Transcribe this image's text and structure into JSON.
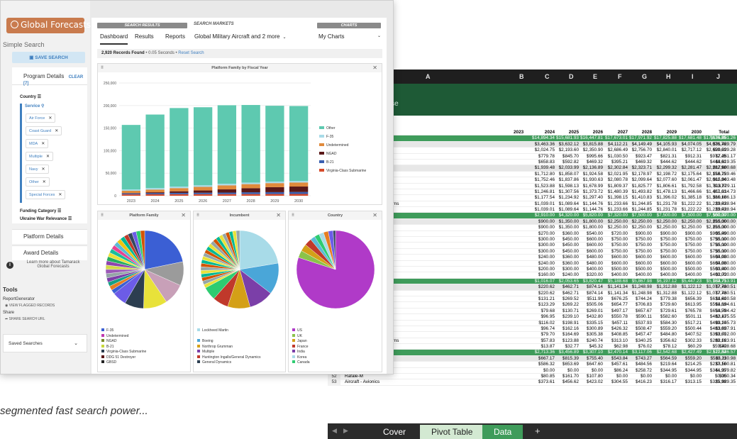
{
  "app": {
    "logo_text": "Global Forecasts",
    "simple_search": "Simple Search",
    "save_search": "SAVE SEARCH",
    "program_details": "Program Details",
    "clear_label": "CLEAR [7]",
    "filters": {
      "country": "Country",
      "service": "Service",
      "funding_category": "Funding Category",
      "ukraine_war": "Ukraine War Relevance"
    },
    "service_chips": [
      "Air Force",
      "Coast Guard",
      "MDA",
      "Multiple",
      "Navy",
      "Other",
      "Special Forces"
    ],
    "platform_details": "Platform Details",
    "award_details": "Award Details",
    "learn_more": "Learn more about Tamarack Global Forecasts",
    "tools": {
      "title": "Tools",
      "report_generator": "ReportGenerator",
      "view_flagged": "VIEW FLAGGED RECORDS",
      "share": "Share",
      "share_url": "SHARE SEARCH URL"
    },
    "saved_searches": "Saved Searches"
  },
  "main": {
    "groups": {
      "search_results": "SEARCH RESULTS",
      "search_markets": "SEARCH MARKETS",
      "charts": "CHARTS"
    },
    "tabs": [
      "Dashboard",
      "Results",
      "Reports"
    ],
    "market_select": "Global Military Aircraft and 2 more",
    "charts_select": "My Charts",
    "records_count": "2,920 Records Found",
    "records_time": "0.05 Seconds",
    "reset_search": "Reset Search"
  },
  "colors": {
    "other": "#5ec9b0",
    "f35": "#a8dbe8",
    "undetermined": "#e08a3c",
    "ngad": "#5a1818",
    "b21": "#3a5fb0",
    "vcs": "#d64a2a"
  },
  "chart_data": [
    {
      "type": "bar",
      "title": "Platform Family by Fiscal Year",
      "categories": [
        "2023",
        "2024",
        "2025",
        "2026",
        "2027",
        "2028",
        "2029",
        "2030"
      ],
      "ylim": [
        0,
        250000
      ],
      "yticks": [
        "0",
        "50,000",
        "100,000",
        "150,000",
        "200,000",
        "250,000"
      ],
      "series": [
        {
          "name": "Virginia-Class Submarine",
          "values": [
            3000,
            3200,
            3400,
            3500,
            3600,
            3700,
            3800,
            3900
          ]
        },
        {
          "name": "B-21",
          "values": [
            2000,
            2500,
            3000,
            3200,
            3500,
            4000,
            4200,
            4500
          ]
        },
        {
          "name": "NGAD",
          "values": [
            1000,
            2000,
            3500,
            5000,
            7000,
            9000,
            11000,
            12000
          ]
        },
        {
          "name": "Undetermined",
          "values": [
            5000,
            6000,
            7000,
            8000,
            9000,
            9000,
            9000,
            9000
          ]
        },
        {
          "name": "F-35",
          "values": [
            3000,
            3300,
            3500,
            3500,
            3500,
            3500,
            3500,
            3500
          ]
        },
        {
          "name": "Other",
          "values": [
            143000,
            163000,
            174000,
            173000,
            174000,
            172000,
            168000,
            166000
          ]
        }
      ]
    },
    {
      "type": "pie",
      "title": "Platform Family",
      "legend": [
        "F-35",
        "Undetermined",
        "NGAD",
        "B-21",
        "Virginia-Class Submarine",
        "DDG 51 Destroyer",
        "GBSD"
      ]
    },
    {
      "type": "pie",
      "title": "Incumbent",
      "legend": [
        "Lockheed Martin",
        "",
        "Boeing",
        "Northrop Grumman",
        "Multiple",
        "Huntington Ingalls/General Dynamics",
        "General Dynamics"
      ]
    },
    {
      "type": "pie",
      "title": "Country",
      "legend": [
        "US",
        "UK",
        "Japan",
        "France",
        "India",
        "Korea",
        "Canada"
      ]
    }
  ],
  "sheet": {
    "columns": [
      "A",
      "B",
      "C",
      "D",
      "E",
      "F",
      "G",
      "H",
      "I",
      "J"
    ],
    "subtitle": "ense",
    "year_headers": [
      "2023",
      "2024",
      "2025",
      "2026",
      "2027",
      "2028",
      "2029",
      "2030",
      "Total"
    ],
    "rows": [
      {
        "label": "",
        "vals": [
          "$14,894.34",
          "$15,681.93",
          "$16,447.81",
          "$17,673.01",
          "$17,971.92",
          "$17,825.88",
          "$17,681.48",
          "$17,674.89",
          "$135,851.26"
        ],
        "style": "green"
      },
      {
        "label": "es",
        "vals": [
          "$3,463.36",
          "$3,632.12",
          "$3,815.88",
          "$4,112.21",
          "$4,149.49",
          "$4,105.93",
          "$4,074.05",
          "$4,076.76",
          "$31,429.79"
        ],
        "style": "gray"
      },
      {
        "label": "",
        "vals": [
          "$2,024.75",
          "$2,193.60",
          "$2,350.90",
          "$2,686.49",
          "$2,756.70",
          "$2,840.01",
          "$2,717.12",
          "$2,659.69",
          "$20,229.28"
        ],
        "style": ""
      },
      {
        "label": "",
        "vals": [
          "$779.78",
          "$845.70",
          "$995.66",
          "$1,030.50",
          "$923.47",
          "$821.31",
          "$912.31",
          "$972.45",
          "$7,281.17"
        ],
        "style": ""
      },
      {
        "label": "",
        "vals": [
          "$658.83",
          "$592.82",
          "$469.32",
          "$395.21",
          "$469.32",
          "$444.62",
          "$444.62",
          "$444.62",
          "$3,919.35"
        ],
        "style": ""
      },
      {
        "label": "s",
        "vals": [
          "$1,939.48",
          "$2,033.99",
          "$2,136.89",
          "$2,302.84",
          "$2,323.71",
          "$2,299.32",
          "$2,281.47",
          "$2,282.98",
          "$17,600.68"
        ],
        "style": "gray"
      },
      {
        "label": "",
        "vals": [
          "$1,712.80",
          "$1,858.07",
          "$1,924.58",
          "$2,021.95",
          "$2,178.97",
          "$2,198.72",
          "$2,175.64",
          "$2,158.75",
          "$16,229.46"
        ],
        "style": ""
      },
      {
        "label": "on",
        "vals": [
          "$1,752.46",
          "$1,837.86",
          "$1,930.63",
          "$2,080.78",
          "$2,099.64",
          "$2,077.60",
          "$2,061.47",
          "$2,062.84",
          "$15,903.48"
        ],
        "style": ""
      },
      {
        "label": "",
        "vals": [
          "$1,523.88",
          "$1,598.13",
          "$1,678.99",
          "$1,809.37",
          "$1,825.77",
          "$1,806.61",
          "$1,792.58",
          "$1,793.77",
          "$13,829.11"
        ],
        "style": ""
      },
      {
        "label": "",
        "vals": [
          "$1,246.81",
          "$1,307.56",
          "$1,373.72",
          "$1,480.39",
          "$1,493.82",
          "$1,478.13",
          "$1,466.66",
          "$1,467.63",
          "$11,314.73"
        ],
        "style": ""
      },
      {
        "label": "",
        "vals": [
          "$1,177.54",
          "$1,234.92",
          "$1,297.40",
          "$1,398.15",
          "$1,410.83",
          "$1,396.02",
          "$1,385.18",
          "$1,386.10",
          "$10,686.13"
        ],
        "style": ""
      },
      {
        "label": "Systems",
        "vals": [
          "$1,039.01",
          "$1,089.64",
          "$1,144.76",
          "$1,233.66",
          "$1,244.85",
          "$1,231.78",
          "$1,222.22",
          "$1,223.03",
          "$9,428.94"
        ],
        "style": ""
      },
      {
        "label": "",
        "vals": [
          "$1,039.01",
          "$1,089.64",
          "$1,144.76",
          "$1,233.66",
          "$1,244.85",
          "$1,231.78",
          "$1,222.22",
          "$1,223.03",
          "$9,428.94"
        ],
        "style": ""
      },
      {
        "label": "",
        "vals": [
          "$2,910.00",
          "$4,320.00",
          "$5,820.00",
          "$7,320.00",
          "$7,500.00",
          "$7,500.00",
          "$7,500.00",
          "$7,500.00",
          "$50,370.00"
        ],
        "style": "green"
      },
      {
        "label": "es",
        "vals": [
          "$900.00",
          "$1,350.00",
          "$1,800.00",
          "$2,250.00",
          "$2,250.00",
          "$2,250.00",
          "$2,250.00",
          "$2,250.00",
          "$15,300.00"
        ],
        "style": "gray"
      },
      {
        "label": "",
        "vals": [
          "$900.00",
          "$1,350.00",
          "$1,800.00",
          "$2,250.00",
          "$2,250.00",
          "$2,250.00",
          "$2,250.00",
          "$2,250.00",
          "$15,300.00"
        ],
        "style": ""
      },
      {
        "label": "",
        "vals": [
          "$270.00",
          "$360.00",
          "$540.00",
          "$720.00",
          "$900.00",
          "$900.00",
          "$900.00",
          "$900.00",
          "$5,490.00"
        ],
        "style": ""
      },
      {
        "label": "",
        "vals": [
          "$300.00",
          "$450.00",
          "$600.00",
          "$750.00",
          "$750.00",
          "$750.00",
          "$750.00",
          "$750.00",
          "$5,100.00"
        ],
        "style": ""
      },
      {
        "label": "",
        "vals": [
          "$300.00",
          "$450.00",
          "$600.00",
          "$750.00",
          "$750.00",
          "$750.00",
          "$750.00",
          "$750.00",
          "$5,100.00"
        ],
        "style": ""
      },
      {
        "label": "on",
        "vals": [
          "$300.00",
          "$450.00",
          "$600.00",
          "$750.00",
          "$750.00",
          "$750.00",
          "$750.00",
          "$750.00",
          "$5,100.00"
        ],
        "style": ""
      },
      {
        "label": "",
        "vals": [
          "$240.00",
          "$360.00",
          "$480.00",
          "$600.00",
          "$600.00",
          "$600.00",
          "$600.00",
          "$600.00",
          "$4,080.00"
        ],
        "style": ""
      },
      {
        "label": "s",
        "vals": [
          "$240.00",
          "$360.00",
          "$480.00",
          "$600.00",
          "$600.00",
          "$600.00",
          "$600.00",
          "$600.00",
          "$4,080.00"
        ],
        "style": ""
      },
      {
        "label": "",
        "vals": [
          "$200.00",
          "$300.00",
          "$400.00",
          "$500.00",
          "$500.00",
          "$500.00",
          "$500.00",
          "$500.00",
          "$3,400.00"
        ],
        "style": ""
      },
      {
        "label": "",
        "vals": [
          "$160.00",
          "$240.00",
          "$320.00",
          "$400.00",
          "$400.00",
          "$400.00",
          "$400.00",
          "$400.00",
          "$2,720.00"
        ],
        "style": ""
      },
      {
        "label": "",
        "vals": [
          "$1,016.07",
          "$2,053.65",
          "$3,820.47",
          "$5,188.68",
          "$5,867.98",
          "$6,197.12",
          "$5,447.23",
          "$5,162.71",
          "$34,753.91"
        ],
        "style": "green"
      },
      {
        "label": "es",
        "vals": [
          "$220.62",
          "$462.71",
          "$874.14",
          "$1,141.34",
          "$1,248.98",
          "$1,312.88",
          "$1,122.12",
          "$1,077.73",
          "$7,460.51"
        ],
        "style": "gray"
      },
      {
        "label": "",
        "vals": [
          "$220.62",
          "$462.71",
          "$874.14",
          "$1,141.34",
          "$1,248.98",
          "$1,312.88",
          "$1,122.12",
          "$1,077.73",
          "$7,460.51"
        ],
        "style": ""
      },
      {
        "label": "s",
        "vals": [
          "$131.21",
          "$269.52",
          "$511.99",
          "$676.25",
          "$744.24",
          "$779.38",
          "$656.39",
          "$631.61",
          "$4,400.58"
        ],
        "style": ""
      },
      {
        "label": "",
        "vals": [
          "$123.29",
          "$269.22",
          "$505.06",
          "$654.77",
          "$706.83",
          "$729.60",
          "$613.95",
          "$591.88",
          "$4,194.61"
        ],
        "style": ""
      },
      {
        "label": "",
        "vals": [
          "$79.68",
          "$130.71",
          "$269.01",
          "$497.17",
          "$657.67",
          "$729.61",
          "$765.78",
          "$654.59",
          "$3,784.42"
        ],
        "style": ""
      },
      {
        "label": "",
        "vals": [
          "$96.95",
          "$239.10",
          "$432.80",
          "$550.78",
          "$590.11",
          "$582.60",
          "$501.11",
          "$482.13",
          "$3,475.55"
        ],
        "style": ""
      },
      {
        "label": "on",
        "vals": [
          "$116.02",
          "$198.91",
          "$335.15",
          "$457.11",
          "$537.93",
          "$584.30",
          "$517.21",
          "$499.10",
          "$3,245.73"
        ],
        "style": ""
      },
      {
        "label": "",
        "vals": [
          "$96.74",
          "$162.16",
          "$300.89",
          "$426.32",
          "$508.47",
          "$559.20",
          "$500.44",
          "$483.69",
          "$3,037.91"
        ],
        "style": ""
      },
      {
        "label": "",
        "vals": [
          "$79.70",
          "$164.69",
          "$305.38",
          "$408.85",
          "$457.47",
          "$484.80",
          "$407.52",
          "$393.61",
          "$2,702.00"
        ],
        "style": ""
      },
      {
        "label": "Systems",
        "vals": [
          "$57.83",
          "$123.88",
          "$240.74",
          "$313.10",
          "$340.25",
          "$356.62",
          "$302.33",
          "$289.16",
          "$2,023.91"
        ],
        "style": ""
      },
      {
        "label": "Aircraft - Workstations",
        "num": "47",
        "vals": [
          "$13.87",
          "$32.77",
          "$45.32",
          "$62.98",
          "$76.02",
          "$78.12",
          "$60.29",
          "$59.30",
          "$428.68"
        ],
        "style": ""
      },
      {
        "label": "Rafale",
        "num": "48",
        "vals": [
          "$2,713.36",
          "$3,456.89",
          "$3,307.10",
          "$2,470.14",
          "$3,117.06",
          "$2,542.68",
          "$2,427.49",
          "$2,511.82",
          "$22,546.57"
        ],
        "style": "green"
      },
      {
        "label": "Aircraft - Structures",
        "num": "49",
        "vals": [
          "$667.17",
          "$815.39",
          "$755.40",
          "$543.84",
          "$743.27",
          "$564.59",
          "$559.20",
          "$582.11",
          "$5,230.98"
        ],
        "style": "gray"
      },
      {
        "label": "Rafale",
        "num": "50",
        "vals": [
          "$586.32",
          "$653.69",
          "$647.60",
          "$457.61",
          "$484.56",
          "$219.64",
          "$214.25",
          "$237.16",
          "$3,500.81"
        ],
        "style": ""
      },
      {
        "label": "Rafale F4",
        "num": "51",
        "vals": [
          "$0.00",
          "$0.00",
          "$0.00",
          "$86.24",
          "$258.72",
          "$344.95",
          "$344.95",
          "$344.95",
          "$1,379.82"
        ],
        "style": ""
      },
      {
        "label": "Rafale-M",
        "num": "52",
        "vals": [
          "$80.85",
          "$161.70",
          "$107.80",
          "$0.00",
          "$0.00",
          "$0.00",
          "$0.00",
          "$0.00",
          "$350.34"
        ],
        "style": ""
      },
      {
        "label": "Aircraft - Avionics",
        "num": "53",
        "vals": [
          "$373.61",
          "$456.62",
          "$423.02",
          "$304.55",
          "$416.23",
          "$316.17",
          "$313.15",
          "$325.98",
          "$2,929.35"
        ],
        "style": ""
      }
    ],
    "tabs": [
      "Cover",
      "Pivot Table",
      "Data"
    ]
  },
  "caption": "segmented fast search power..."
}
